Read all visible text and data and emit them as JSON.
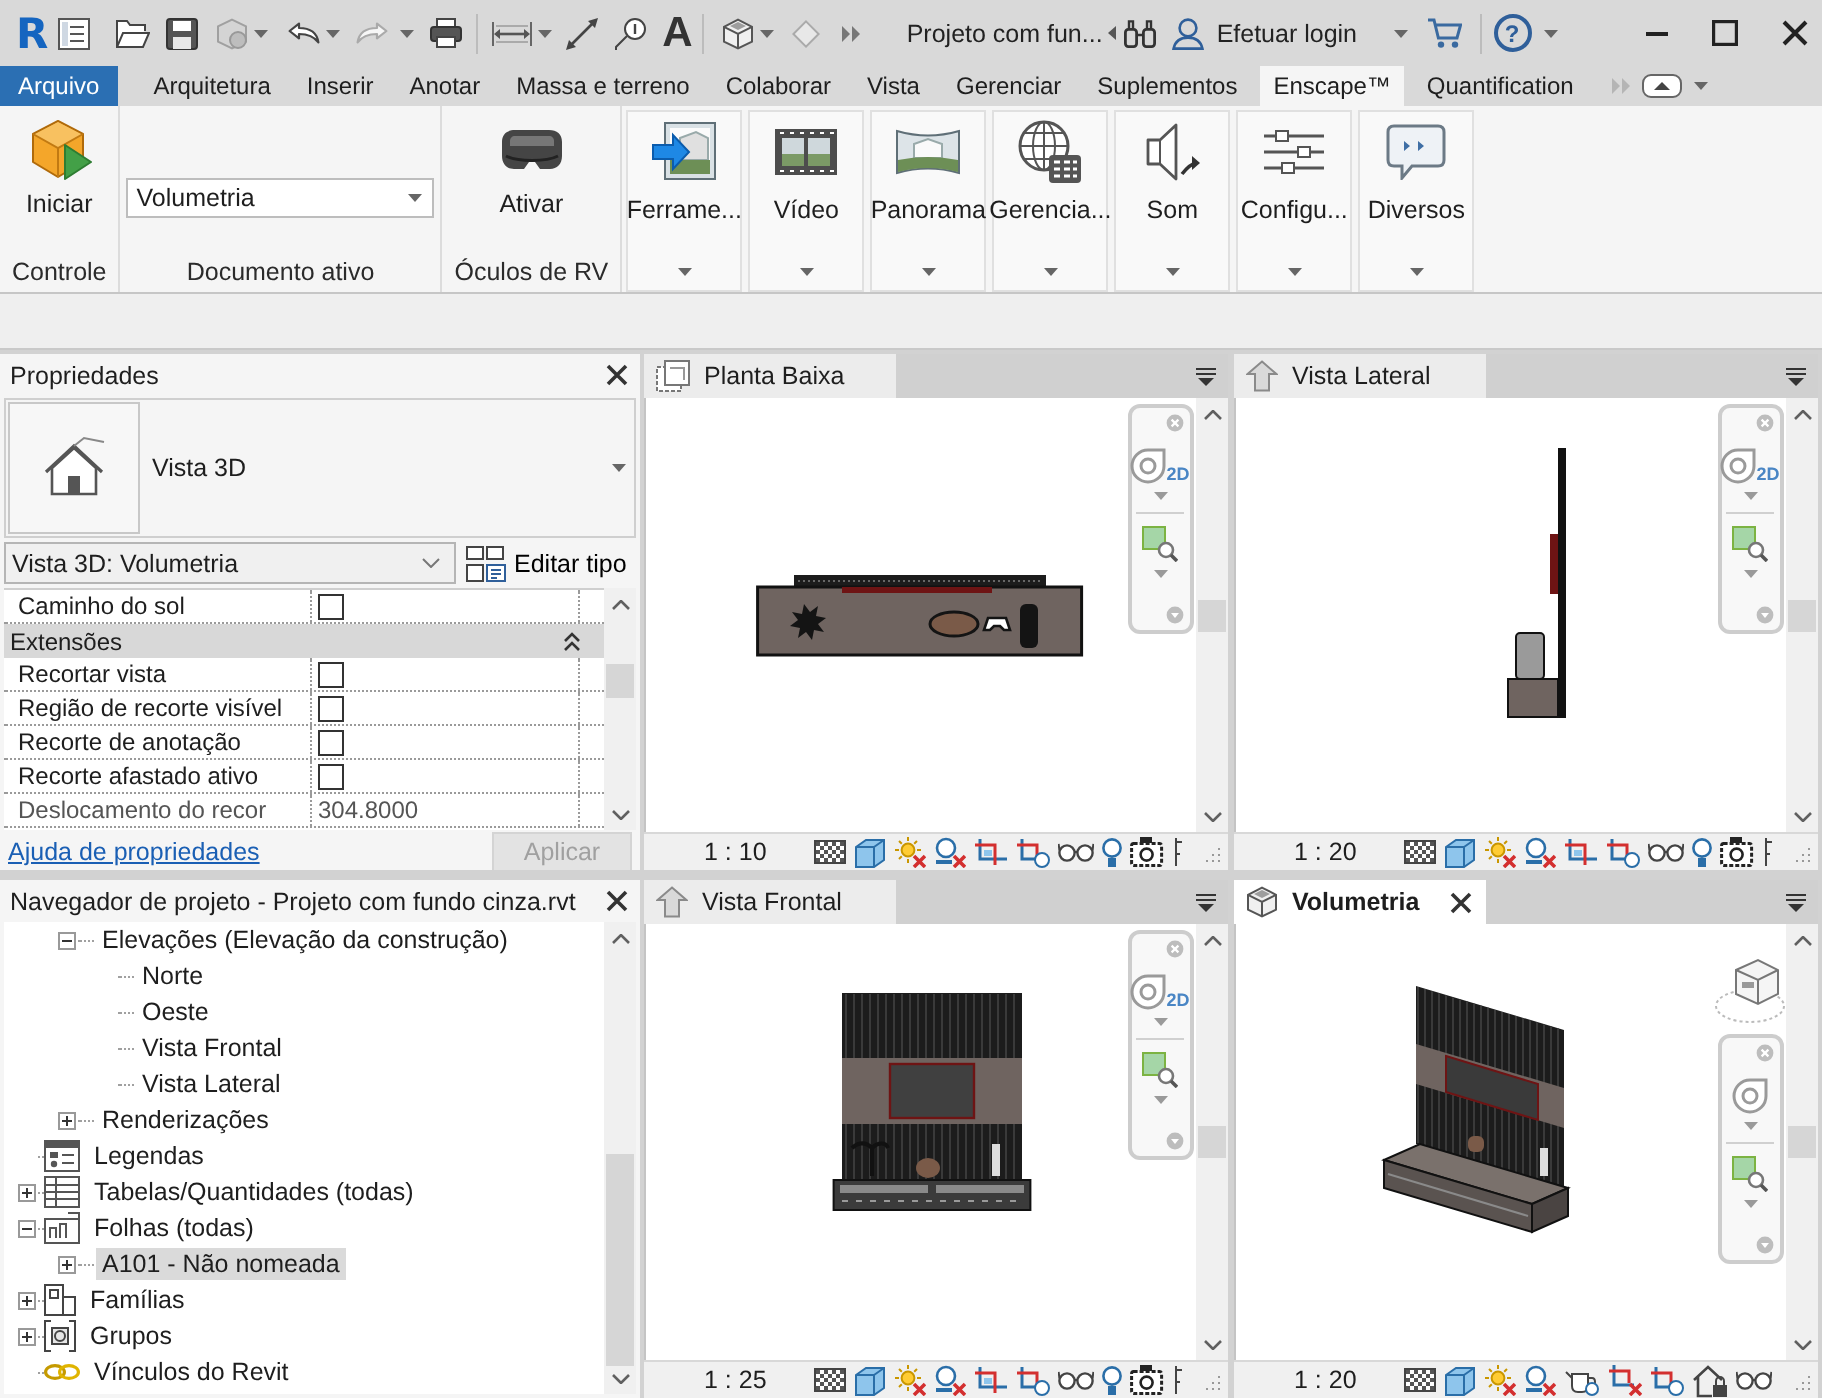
{
  "title_bar": {
    "logo": "R",
    "text_tool": "A",
    "document": "Projeto com fun...",
    "login": "Efetuar login",
    "help": "?"
  },
  "ribbon": {
    "tabs": [
      {
        "label": "Arquivo",
        "kind": "application",
        "selected": false
      },
      {
        "label": "Arquitetura",
        "kind": "tab",
        "selected": false
      },
      {
        "label": "Inserir",
        "kind": "tab",
        "selected": false
      },
      {
        "label": "Anotar",
        "kind": "tab",
        "selected": false
      },
      {
        "label": "Massa e terreno",
        "kind": "tab",
        "selected": false
      },
      {
        "label": "Colaborar",
        "kind": "tab",
        "selected": false
      },
      {
        "label": "Vista",
        "kind": "tab",
        "selected": false
      },
      {
        "label": "Gerenciar",
        "kind": "tab",
        "selected": false
      },
      {
        "label": "Suplementos",
        "kind": "tab",
        "selected": false
      },
      {
        "label": "Enscape™",
        "kind": "tab",
        "selected": true
      },
      {
        "label": "Quantification",
        "kind": "tab",
        "selected": false
      }
    ],
    "panels": [
      {
        "kind": "buttons",
        "title": "Controle",
        "buttons": [
          {
            "kind": "start",
            "label": "Iniciar"
          }
        ]
      },
      {
        "kind": "selector",
        "title": "Documento ativo",
        "value": "Volumetria"
      },
      {
        "kind": "buttons",
        "title": "Óculos de RV",
        "buttons": [
          {
            "kind": "headset",
            "label": "Ativar"
          }
        ]
      },
      {
        "kind": "menus",
        "buttons": [
          {
            "kind": "tools",
            "label": "Ferrame..."
          },
          {
            "kind": "video",
            "label": "Vídeo"
          },
          {
            "kind": "panorama",
            "label": "Panorama"
          },
          {
            "kind": "manage",
            "label": "Gerencia..."
          },
          {
            "kind": "sound",
            "label": "Som"
          },
          {
            "kind": "settings",
            "label": "Configu..."
          },
          {
            "kind": "misc",
            "label": "Diversos"
          }
        ]
      }
    ]
  },
  "properties": {
    "title": "Propriedades",
    "type_name": "Vista 3D",
    "type_selector": "Vista 3D: Volumetria",
    "edit_type": "Editar tipo",
    "rows": [
      {
        "kind": "checkbox",
        "label": "Caminho do sol",
        "checked": false
      },
      {
        "kind": "group",
        "label": "Extensões",
        "expanded": true
      },
      {
        "kind": "checkbox",
        "label": "Recortar vista",
        "checked": false
      },
      {
        "kind": "checkbox",
        "label": "Região de recorte visível",
        "checked": false
      },
      {
        "kind": "checkbox",
        "label": "Recorte de anotação",
        "checked": false
      },
      {
        "kind": "checkbox",
        "label": "Recorte afastado ativo",
        "checked": false
      },
      {
        "kind": "value",
        "label": "Deslocamento do recor",
        "value": "304.8000"
      }
    ],
    "help_link": "Ajuda de propriedades",
    "apply": {
      "label": "Aplicar",
      "disabled": true
    }
  },
  "project_browser": {
    "title": "Navegador de projeto - Projeto com fundo cinza.rvt",
    "tree": [
      {
        "children": [
          {
            "label": "Elevações (Elevação da construção)",
            "expanded": true,
            "selected": false,
            "children": [
              {
                "label": "Norte",
                "selected": false
              },
              {
                "label": "Oeste",
                "selected": false
              },
              {
                "label": "Vista Frontal",
                "selected": false
              },
              {
                "label": "Vista Lateral",
                "selected": false
              }
            ]
          },
          {
            "label": "Renderizações",
            "expanded": false,
            "selected": false
          }
        ]
      },
      {
        "kind": "legends",
        "label": "Legendas",
        "selected": false
      },
      {
        "kind": "schedules",
        "label": "Tabelas/Quantidades (todas)",
        "expanded": false,
        "selected": false
      },
      {
        "kind": "sheets",
        "label": "Folhas (todas)",
        "expanded": true,
        "selected": false,
        "children": [
          {
            "label": "A101 - Não nomeada",
            "expanded": false,
            "selected": true
          }
        ]
      },
      {
        "kind": "families",
        "label": "Famílias",
        "expanded": false,
        "selected": false
      },
      {
        "kind": "groups",
        "label": "Grupos",
        "expanded": false,
        "selected": false
      },
      {
        "kind": "links",
        "label": "Vínculos do Revit",
        "selected": false
      }
    ]
  },
  "views": [
    {
      "kind": "plan",
      "title": "Planta Baixa",
      "selected": false,
      "scale": "1 : 10",
      "wheel_badge": "2D"
    },
    {
      "kind": "side",
      "title": "Vista Lateral",
      "selected": false,
      "scale": "1 : 20",
      "wheel_badge": "2D"
    },
    {
      "kind": "front",
      "title": "Vista Frontal",
      "selected": false,
      "scale": "1 : 25",
      "wheel_badge": "2D"
    },
    {
      "kind": "iso",
      "title": "Volumetria",
      "selected": true,
      "scale": "1 : 20"
    }
  ]
}
